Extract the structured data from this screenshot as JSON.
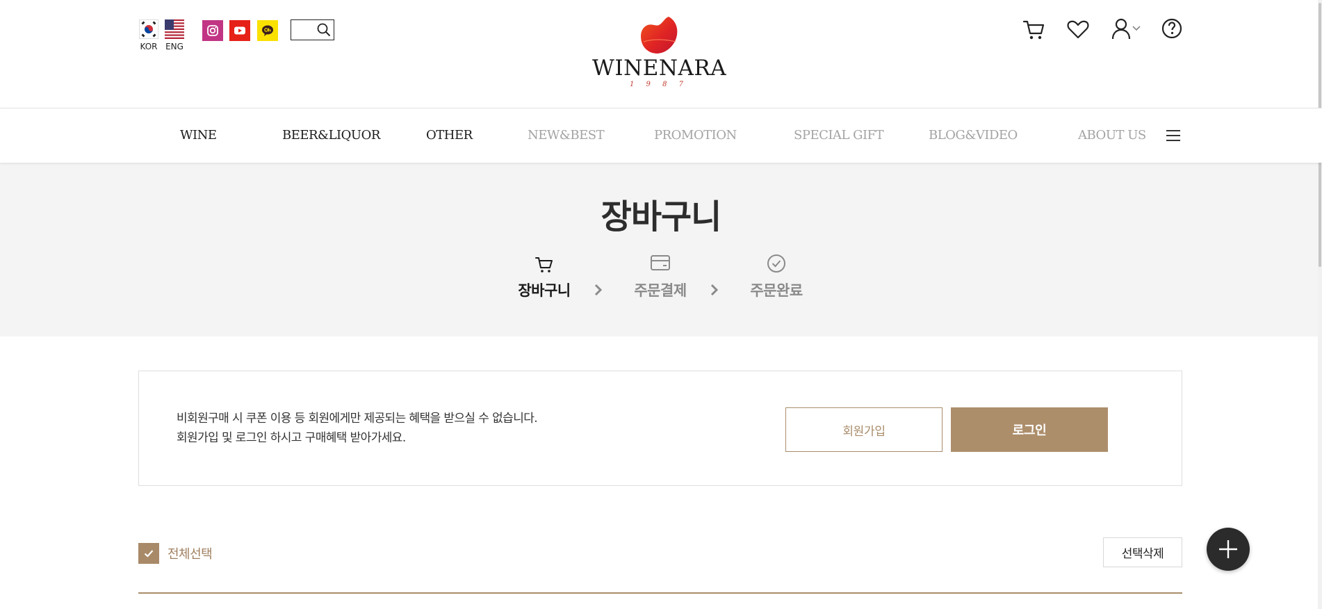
{
  "header": {
    "languages": [
      {
        "label": "KOR"
      },
      {
        "label": "ENG"
      }
    ],
    "social": [
      "instagram-icon",
      "youtube-icon",
      "kakao-channel-icon"
    ],
    "search": {
      "placeholder": ""
    },
    "logo": {
      "name": "WINENARA",
      "year": "1 9 8 7"
    },
    "utilities": [
      "cart-icon",
      "heart-icon",
      "user-icon",
      "help-icon"
    ]
  },
  "gnb": {
    "items": [
      {
        "label": "WINE"
      },
      {
        "label": "BEER&LIQUOR"
      },
      {
        "label": "OTHER"
      },
      {
        "label": "NEW&BEST"
      },
      {
        "label": "PROMOTION"
      },
      {
        "label": "SPECIAL GIFT"
      },
      {
        "label": "BLOG&VIDEO"
      },
      {
        "label": "ABOUT US"
      }
    ]
  },
  "page": {
    "title": "장바구니",
    "steps": [
      {
        "label": "장바구니",
        "state": "active"
      },
      {
        "label": "주문결제",
        "state": "inactive"
      },
      {
        "label": "주문완료",
        "state": "inactive"
      }
    ]
  },
  "notice": {
    "line1": "비회원구매 시 쿠폰 이용 등 회원에게만 제공되는 혜택을 받으실 수 없습니다.",
    "line2": "회원가입 및 로그인 하시고 구매혜택 받아가세요.",
    "join_label": "회원가입",
    "login_label": "로그인"
  },
  "list": {
    "select_all_label": "전체선택",
    "select_all_checked": true,
    "delete_selected_label": "선택삭제"
  },
  "colors": {
    "accent": "#ad8e6b",
    "accent_text": "#a08060",
    "hero_bg": "#f4f4f4",
    "logo_red": "#e0281e"
  }
}
